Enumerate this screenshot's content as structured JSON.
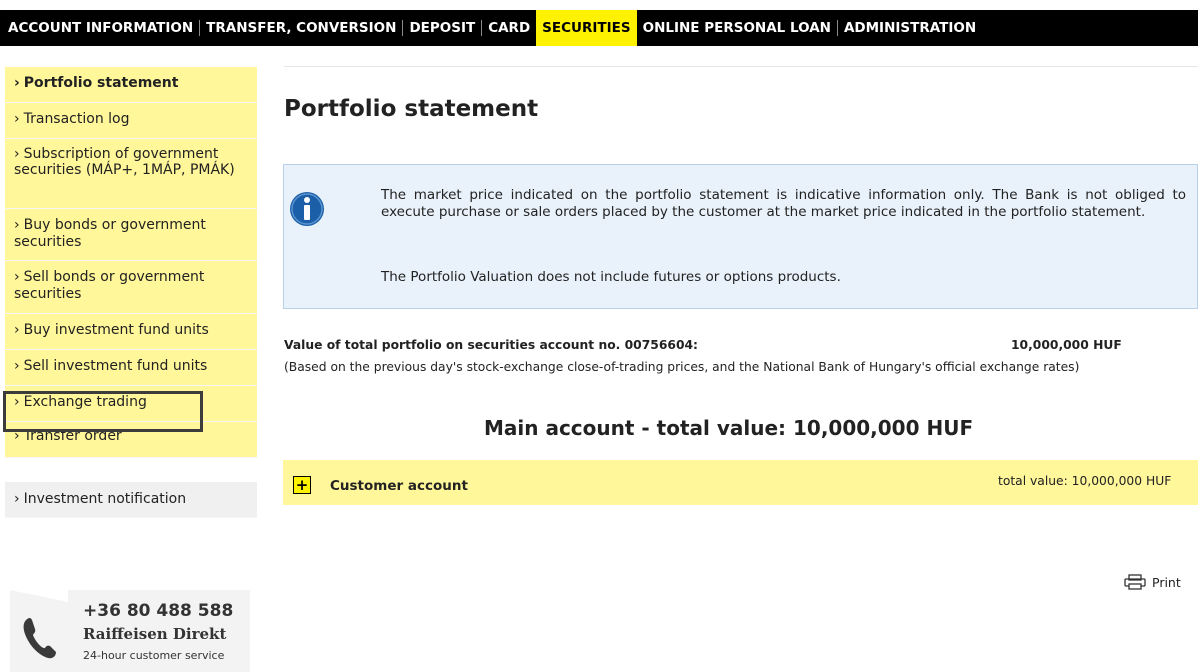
{
  "topnav": {
    "items": [
      {
        "label": "ACCOUNT INFORMATION",
        "active": false
      },
      {
        "label": "TRANSFER, CONVERSION",
        "active": false
      },
      {
        "label": "DEPOSIT",
        "active": false
      },
      {
        "label": "CARD",
        "active": false
      },
      {
        "label": "SECURITIES",
        "active": true
      },
      {
        "label": "ONLINE PERSONAL LOAN",
        "active": false
      },
      {
        "label": "ADMINISTRATION",
        "active": false
      }
    ]
  },
  "sidebar": {
    "items": [
      {
        "label": "Portfolio statement",
        "bold": true
      },
      {
        "label": "Transaction log"
      },
      {
        "label": "Subscription of government securities (MÁP+, 1MÁP, PMÁK)"
      },
      {
        "label": "Buy bonds or government securities"
      },
      {
        "label": "Sell bonds or government securities"
      },
      {
        "label": "Buy investment fund units"
      },
      {
        "label": "Sell investment fund units"
      },
      {
        "label": "Exchange trading"
      },
      {
        "label": "Transfer order"
      }
    ],
    "extra": {
      "label": "Investment notification"
    },
    "chevron": "›"
  },
  "contact": {
    "phone": "+36 80 488 588",
    "name": "Raiffeisen Direkt",
    "service": "24-hour customer service",
    "icon": "telephone-icon"
  },
  "main": {
    "title": "Portfolio statement",
    "info": {
      "icon": "info-icon",
      "paragraph1": "The market price indicated on the portfolio statement is indicative information only. The Bank is not obliged to execute purchase or sale orders placed by the customer at the market price indicated in the portfolio statement.",
      "paragraph2": "The Portfolio Valuation does not include futures or options products."
    },
    "portfolio_value": {
      "label": "Value of total portfolio on securities account no. 00756604:",
      "amount": "10,000,000  HUF",
      "note": "(Based on the previous day's stock-exchange close-of-trading prices, and the National Bank of Hungary's official exchange rates)"
    },
    "main_account_total": "Main account - total value: 10,000,000 HUF",
    "account_row": {
      "expand_symbol": "+",
      "name": "Customer account",
      "total": "total value:  10,000,000 HUF"
    },
    "print": {
      "label": "Print",
      "icon": "printer-icon"
    }
  },
  "colors": {
    "brand_yellow": "#fff200",
    "pale_yellow": "#fff799",
    "nav_black": "#000000",
    "info_bg": "#e9f2fb",
    "info_blue": "#1a5fa8"
  }
}
